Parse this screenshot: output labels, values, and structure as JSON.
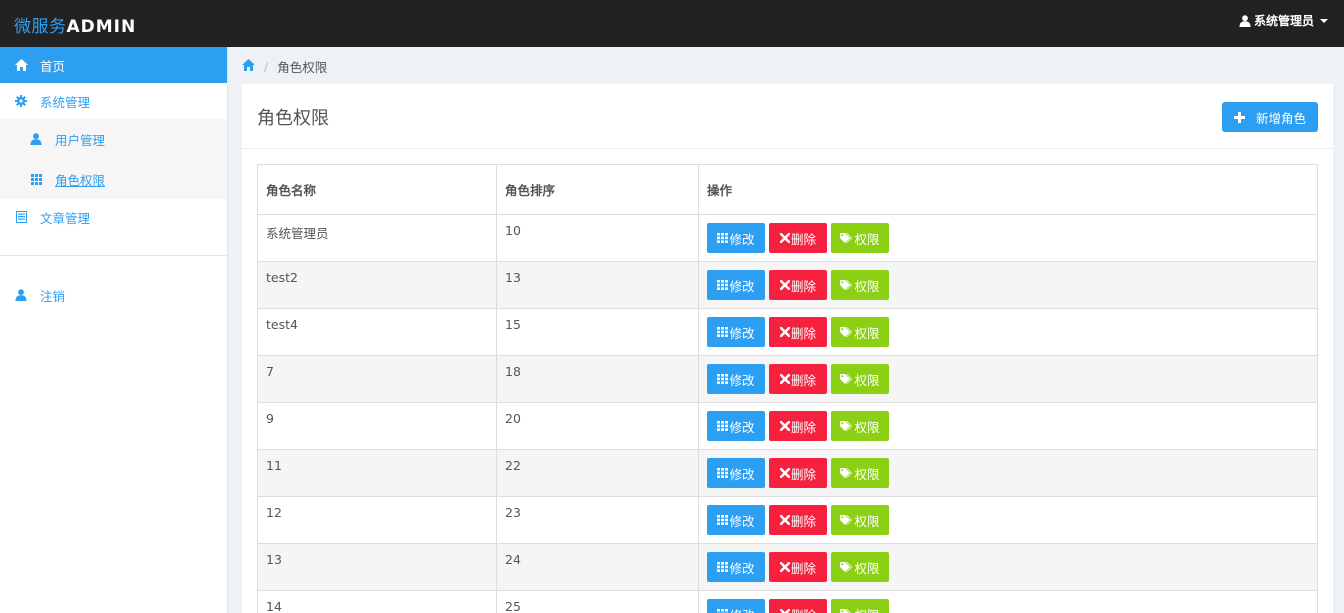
{
  "brand": {
    "cn": "微服务",
    "en": "ADMIN"
  },
  "user_menu": {
    "label": "系统管理员"
  },
  "sidebar": {
    "home": "首页",
    "system": "系统管理",
    "users": "用户管理",
    "roles": "角色权限",
    "articles": "文章管理",
    "logout": "注销"
  },
  "breadcrumb": {
    "current": "角色权限"
  },
  "panel": {
    "title": "角色权限",
    "add_label": "新增角色"
  },
  "table": {
    "headers": [
      "角色名称",
      "角色排序",
      "操作"
    ],
    "actions": {
      "edit": "修改",
      "delete": "删除",
      "perm": "权限"
    },
    "rows": [
      {
        "name": "系统管理员",
        "order": "10"
      },
      {
        "name": "test2",
        "order": "13"
      },
      {
        "name": "test4",
        "order": "15"
      },
      {
        "name": "7",
        "order": "18"
      },
      {
        "name": "9",
        "order": "20"
      },
      {
        "name": "11",
        "order": "22"
      },
      {
        "name": "12",
        "order": "23"
      },
      {
        "name": "13",
        "order": "24"
      },
      {
        "name": "14",
        "order": "25"
      }
    ]
  },
  "colors": {
    "primary": "#2d9ff3",
    "danger": "#f5213f",
    "success": "#8cd016",
    "topbar": "#222222"
  }
}
